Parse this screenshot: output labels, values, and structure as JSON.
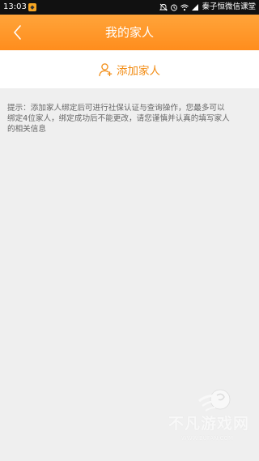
{
  "status_bar": {
    "time": "13:03",
    "app_badge": "◆",
    "carrier": "秦子恒微信课堂"
  },
  "header": {
    "title": "我的家人",
    "back_icon": "chevron-left-icon"
  },
  "add_family": {
    "label": "添加家人",
    "icon": "add-person-icon"
  },
  "tip": {
    "text": "提示：添加家人绑定后可进行社保认证与查询操作，您最多可以\n绑定4位家人，绑定成功后不能更改，请您谨慎并认真的填写家人\n的相关信息"
  },
  "watermark": {
    "text": "不凡游戏网",
    "url": "WWW.BUFAN.COM"
  },
  "colors": {
    "accent": "#ff9a2a",
    "accent_text": "#f28c14",
    "background": "#efefef"
  }
}
